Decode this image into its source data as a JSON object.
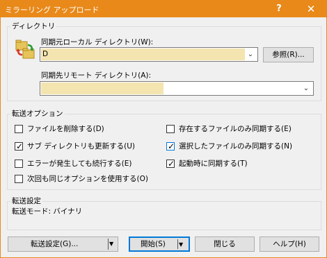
{
  "window": {
    "title": "ミラーリング アップロード",
    "help_glyph": "?",
    "close_glyph": "✕"
  },
  "directory": {
    "group_label": "ディレクトリ",
    "local_label": "同期元ローカル ディレクトリ(W):",
    "local_value": "D",
    "browse_button": "参照(R)...",
    "remote_label": "同期先リモート ディレクトリ(A):",
    "remote_value": ""
  },
  "options": {
    "group_label": "転送オプション",
    "items": [
      {
        "label": "ファイルを削除する(D)",
        "checked": false
      },
      {
        "label": "サブ ディレクトリも更新する(U)",
        "checked": true
      },
      {
        "label": "エラーが発生しても続行する(E)",
        "checked": false
      },
      {
        "label": "次回も同じオプションを使用する(O)",
        "checked": false
      },
      {
        "label": "存在するファイルのみ同期する(E)",
        "checked": false
      },
      {
        "label": "選択したファイルのみ同期する(N)",
        "checked": true
      },
      {
        "label": "起動時に同期する(T)",
        "checked": true
      }
    ]
  },
  "transfer": {
    "group_label": "転送設定",
    "mode_text": "転送モード: バイナリ"
  },
  "buttons": {
    "settings": "転送設定(G)...",
    "start": "開始(S)",
    "close": "閉じる",
    "help": "ヘルプ(H)",
    "dropdown_glyph": "▼"
  }
}
